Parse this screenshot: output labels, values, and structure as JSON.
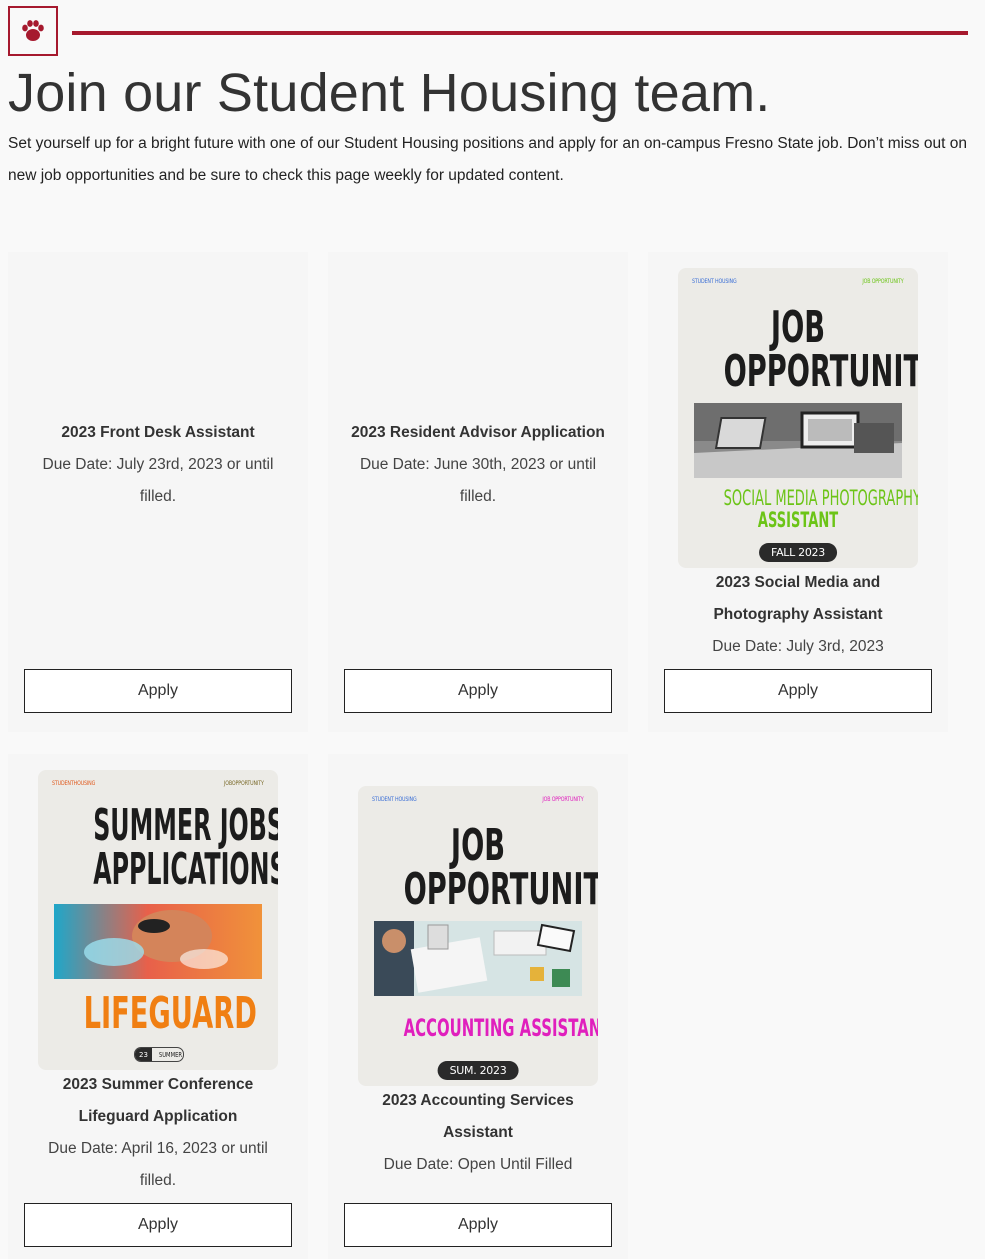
{
  "header": {
    "logo_icon": "paw-icon",
    "accent_color": "#a6192e",
    "title": "Join our Student Housing team.",
    "intro": "Set yourself up for a bright future with one of our Student Housing positions and apply for an on-campus Fresno State job. Don’t miss out on new job opportunities and be sure to check this page weekly for updated content."
  },
  "jobs": [
    {
      "title": "2023 Front Desk Assistant",
      "due": "Due Date: July 23rd, 2023 or until filled.",
      "apply_label": "Apply"
    },
    {
      "title": "2023 Resident Advisor Application",
      "due": "Due Date: June 30th, 2023 or until filled.",
      "apply_label": "Apply"
    },
    {
      "title": "2023 Social Media and Photography Assistant",
      "due": "Due Date: July 3rd, 2023",
      "apply_label": "Apply",
      "poster": {
        "top_left": "STUDENT HOUSING",
        "top_right": "JOB OPPORTUNITY",
        "line1": "JOB",
        "line2": "OPPORTUNITY",
        "subtitle1": "SOCIAL MEDIA PHOTOGRAPHY",
        "subtitle2": "ASSISTANT",
        "pill": "FALL 2023",
        "accent": "#6cc417"
      }
    },
    {
      "title": "2023 Summer Conference Lifeguard Application",
      "due": "Due Date: April 16, 2023 or until filled.",
      "apply_label": "Apply",
      "poster": {
        "top_left": "STUDENTHOUSING",
        "top_right": "JOBOPPORTUNITY",
        "line1": "SUMMER JOBS",
        "line2": "APPLICATIONS",
        "subtitle1": "LIFEGUARD",
        "pill_left": "23",
        "pill_right": "SUMMER",
        "accent": "#f07f13"
      }
    },
    {
      "title": "2023 Accounting Services Assistant",
      "due": "Due Date: Open Until Filled",
      "apply_label": "Apply",
      "poster": {
        "top_left": "STUDENT HOUSING",
        "top_right": "JOB OPPORTUNITY",
        "line1": "JOB",
        "line2": "OPPORTUNITY",
        "subtitle1": "ACCOUNTING ASSISTANT",
        "pill": "SUM. 2023",
        "accent": "#e01fbd"
      }
    }
  ]
}
